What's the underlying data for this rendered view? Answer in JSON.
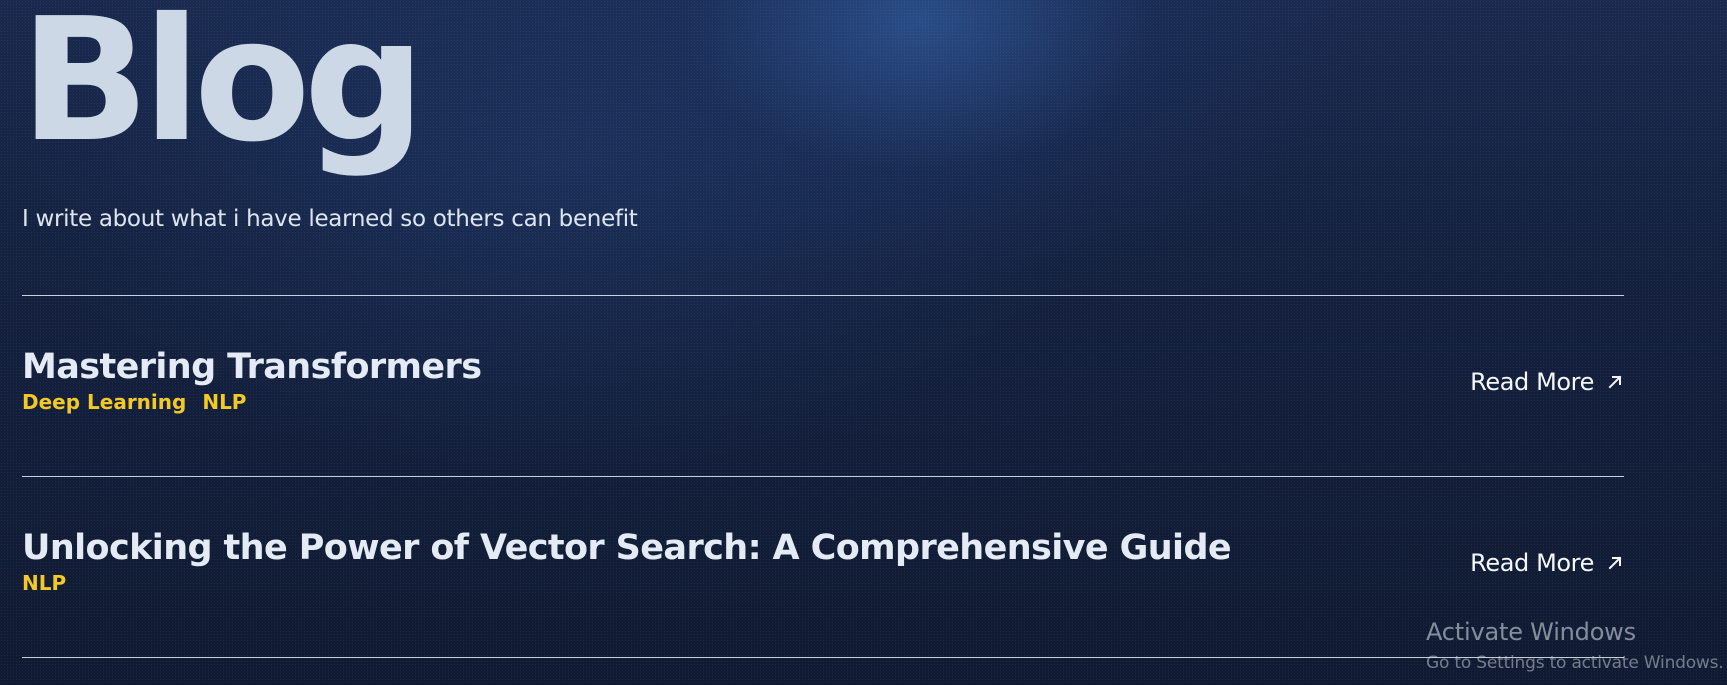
{
  "header": {
    "title": "Blog",
    "subtitle": "I write about what i have learned so others can benefit"
  },
  "posts": [
    {
      "title": "Mastering Transformers",
      "tags": [
        "Deep Learning",
        "NLP"
      ],
      "read_more_label": "Read More",
      "icon": "arrow-up-right-icon"
    },
    {
      "title": "Unlocking the Power of Vector Search: A Comprehensive Guide",
      "tags": [
        "NLP"
      ],
      "read_more_label": "Read More",
      "icon": "arrow-up-right-icon"
    }
  ],
  "watermark": {
    "title": "Activate Windows",
    "subtitle": "Go to Settings to activate Windows."
  },
  "colors": {
    "background_top": "#1a2a4f",
    "background_bottom": "#101a32",
    "title_text": "#cdd8e6",
    "post_title": "#e4ebf5",
    "tag_accent": "#f4c926",
    "divider": "#dae3f0"
  }
}
